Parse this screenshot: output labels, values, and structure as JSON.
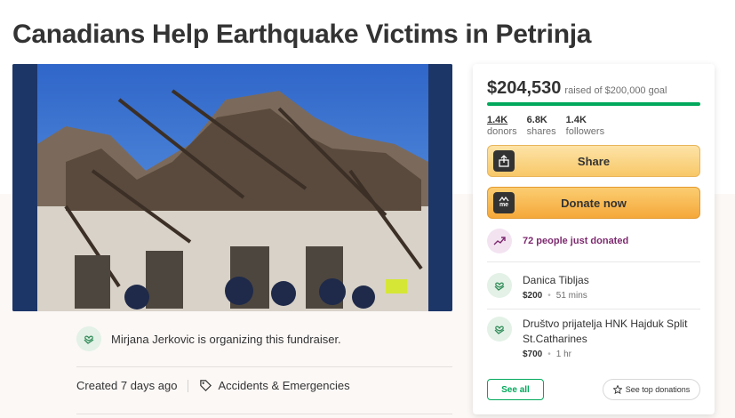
{
  "page": {
    "title": "Canadians Help Earthquake Victims in Petrinja"
  },
  "hero": {
    "alt_icon": "collapsed-building-photo"
  },
  "organizer": {
    "text": "Mirjana Jerkovic is organizing this fundraiser.",
    "icon": "heart-hand-icon"
  },
  "meta": {
    "created": "Created 7 days ago",
    "category": "Accidents & Emergencies",
    "category_icon": "tag-icon"
  },
  "sidebar": {
    "raised_amount": "$204,530",
    "goal_text": "raised of $200,000 goal",
    "progress_fraction": 1.0,
    "stats": [
      {
        "value": "1.4K",
        "label": "donors"
      },
      {
        "value": "6.8K",
        "label": "shares"
      },
      {
        "value": "1.4K",
        "label": "followers"
      }
    ],
    "share_label": "Share",
    "donate_label": "Donate now",
    "donate_icon_text": "me",
    "recent_text": "72 people just donated",
    "donations": [
      {
        "name": "Danica Tibljas",
        "amount": "$200",
        "time": "51 mins"
      },
      {
        "name": "Društvo prijatelja HNK Hajduk Split St.Catharines",
        "amount": "$700",
        "time": "1 hr"
      }
    ],
    "see_all_label": "See all",
    "top_donations_label": "See top donations"
  },
  "colors": {
    "accent_green": "#02a95c",
    "share_yellow": "#f8c868",
    "donate_orange": "#f5a83a",
    "recent_purple": "#7d2a6f"
  }
}
